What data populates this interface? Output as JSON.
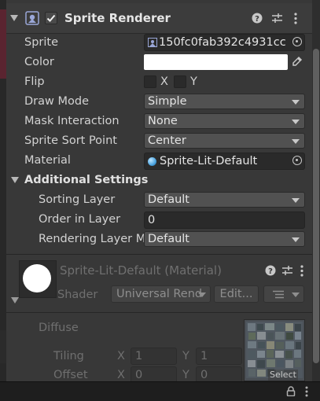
{
  "header": {
    "component_title": "Sprite Renderer",
    "enabled": true
  },
  "fields": {
    "sprite": {
      "label": "Sprite",
      "value": "150fc0fab392c4931cc"
    },
    "color": {
      "label": "Color",
      "value": "#ffffff"
    },
    "flip": {
      "label": "Flip",
      "x_label": "X",
      "y_label": "Y",
      "x_checked": false,
      "y_checked": false
    },
    "draw_mode": {
      "label": "Draw Mode",
      "value": "Simple"
    },
    "mask_interaction": {
      "label": "Mask Interaction",
      "value": "None"
    },
    "sprite_sort_point": {
      "label": "Sprite Sort Point",
      "value": "Center"
    },
    "material": {
      "label": "Material",
      "value": "Sprite-Lit-Default"
    }
  },
  "additional": {
    "title": "Additional Settings",
    "sorting_layer": {
      "label": "Sorting Layer",
      "value": "Default"
    },
    "order_in_layer": {
      "label": "Order in Layer",
      "value": "0"
    },
    "rendering_layer": {
      "label": "Rendering Layer M",
      "value": "Default"
    }
  },
  "material_panel": {
    "title": "Sprite-Lit-Default (Material)",
    "shader_label": "Shader",
    "shader_value": "Universal Rend",
    "edit_label": "Edit...",
    "diffuse_label": "Diffuse",
    "tiling_label": "Tiling",
    "offset_label": "Offset",
    "tiling": {
      "x_label": "X",
      "x": "1",
      "y_label": "Y",
      "y": "1"
    },
    "offset": {
      "x_label": "X",
      "x": "0",
      "y_label": "Y",
      "y": "0"
    },
    "select_label": "Select"
  },
  "colors": {
    "background": "#383838",
    "field": "#2a2a2a",
    "dropdown": "#515151",
    "accent_sphere": "#4aa3df"
  }
}
